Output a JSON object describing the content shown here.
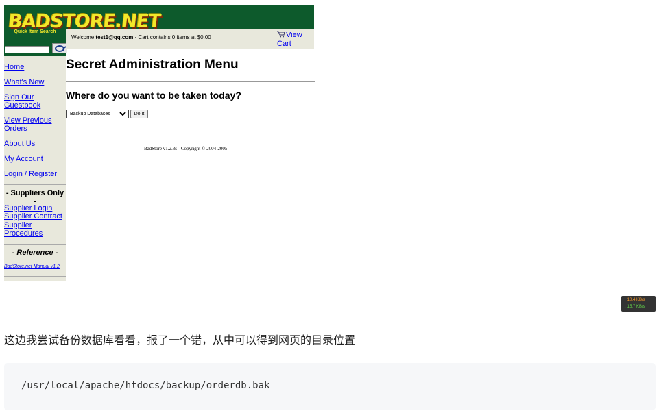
{
  "header": {
    "logo": "BADSTORE.NET",
    "search_title": "Quick Item Search",
    "search_value": "",
    "welcome_prefix": "Welcome ",
    "welcome_user": "test1@qq.com",
    "welcome_suffix": " - Cart contains 0 items at $0.00",
    "cart_link": "View Cart"
  },
  "sidebar": {
    "nav": [
      "Home",
      "What's New",
      "Sign Our Guestbook",
      "View Previous Orders",
      "About Us",
      "My Account",
      "Login / Register"
    ],
    "suppliers_heading": "- Suppliers Only -",
    "suppliers": [
      "Supplier Login",
      "Supplier Contract",
      "Supplier Procedures"
    ],
    "reference_heading": "- Reference -",
    "reference_link": "BadStore.net Manual v1.2"
  },
  "main": {
    "title": "Secret Administration Menu",
    "subtitle": "Where do you want to be taken today?",
    "select_value": "Backup Databases",
    "go_button": "Do It",
    "copyright": "BadStore v1.2.3s - Copyright © 2004-2005"
  },
  "net_speed": {
    "up": "↑ 10.4 KB/s",
    "down": "↓ 15.7 KB/s"
  },
  "post": {
    "note": "这边我尝试备份数据库看看，报了一个错，从中可以得到网页的目录位置",
    "code": "/usr/local/apache/htdocs/backup/orderdb.bak"
  },
  "colors": {
    "header_green": "#0d5a2c",
    "logo_yellow": "#f2e82a",
    "sidebar_bg": "#e8e8dc",
    "link_blue": "#0000ee"
  }
}
